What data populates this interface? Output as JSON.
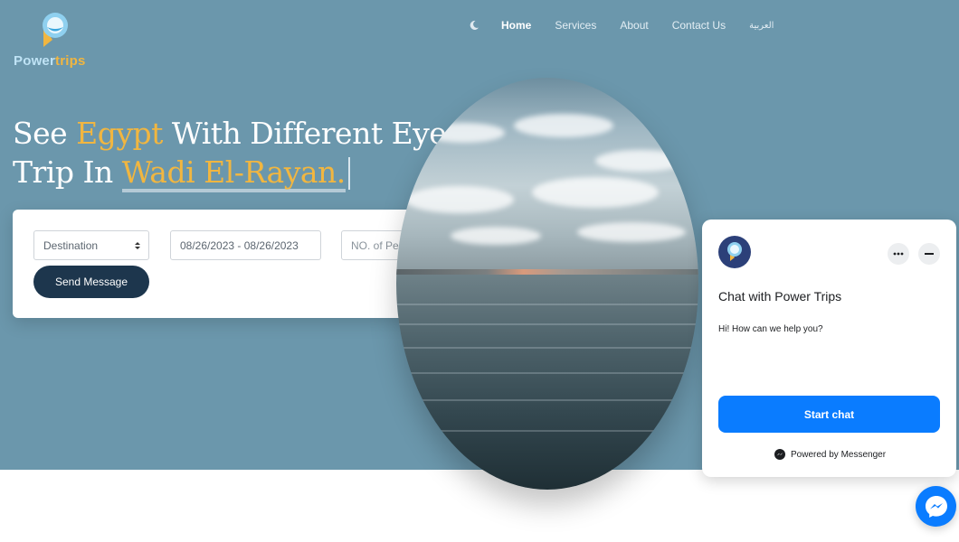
{
  "logo": {
    "word1": "Power",
    "word2": "trips",
    "accent": "#f1b640"
  },
  "nav": {
    "theme_icon": "moon-icon",
    "items": [
      "Home",
      "Services",
      "About",
      "Contact Us",
      "العربية"
    ],
    "active": "Home"
  },
  "hero": {
    "line1_before": "See ",
    "line1_highlight": "Egypt",
    "line1_after": " With Different Eyes",
    "line2_before": "Trip In ",
    "line2_highlight": "Wadi El-Rayan.",
    "background": "#6b97ac"
  },
  "booking": {
    "destination_value": "Destination",
    "dates_value": "08/26/2023 - 08/26/2023",
    "people_placeholder": "NO. of People",
    "send_label": "Send Message"
  },
  "chat": {
    "title": "Chat with Power Trips",
    "greeting": "Hi! How can we help you?",
    "start_label": "Start chat",
    "powered_by": "Powered by Messenger",
    "brand_color": "#0a7cff"
  }
}
